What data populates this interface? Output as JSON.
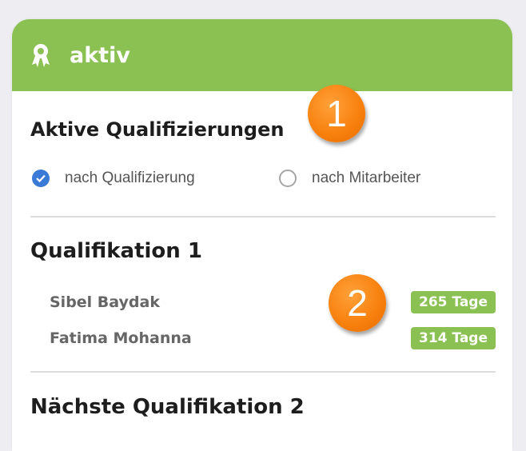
{
  "header": {
    "title": "aktiv",
    "icon": "award-ribbon-icon",
    "color": "#8bc153"
  },
  "section_active": {
    "title": "Aktive Qualifizierungen",
    "options": [
      {
        "label": "nach Qualifizierung",
        "checked": true
      },
      {
        "label": "nach Mitarbeiter",
        "checked": false
      }
    ]
  },
  "qualification_1": {
    "title": "Qualifikation 1",
    "rows": [
      {
        "name": "Sibel Baydak",
        "badge": "265 Tage"
      },
      {
        "name": "Fatima Mohanna",
        "badge": "314 Tage"
      }
    ]
  },
  "qualification_2": {
    "title": "Nächste Qualifikation 2"
  },
  "markers": [
    "1",
    "2"
  ]
}
